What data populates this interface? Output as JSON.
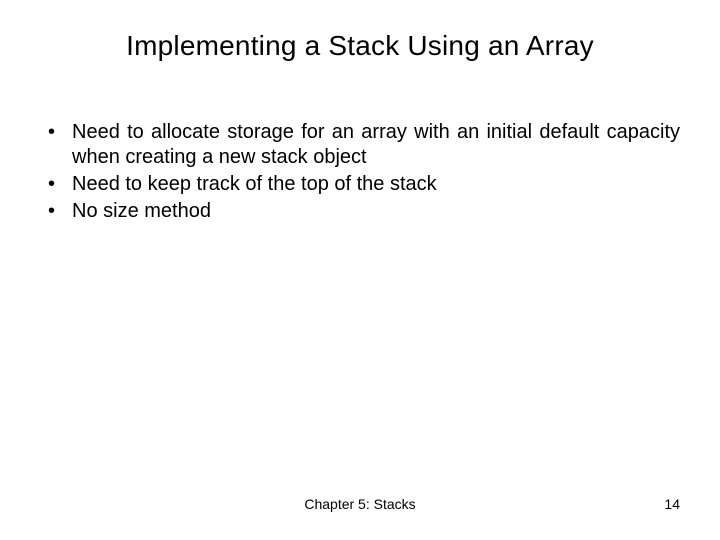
{
  "title": "Implementing a Stack Using an Array",
  "bullets": [
    "Need to allocate storage for an array with an initial default capacity when creating a new stack object",
    "Need to keep track of the top of the stack",
    "No size method"
  ],
  "footer": {
    "chapter": "Chapter 5: Stacks",
    "page": "14"
  }
}
